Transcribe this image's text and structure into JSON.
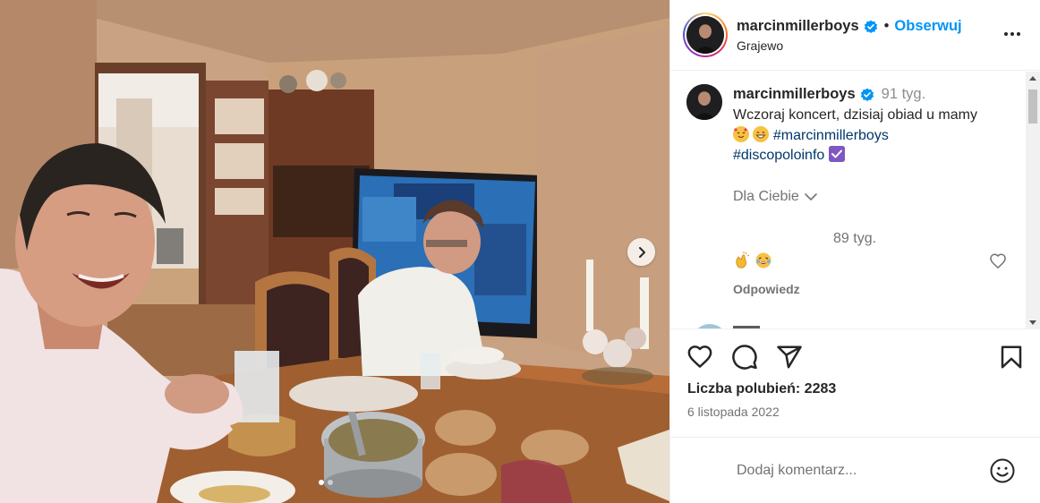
{
  "post": {
    "photo_description_icon": "photo-image",
    "carousel": {
      "slide_count": 2,
      "active_index": 0
    }
  },
  "header": {
    "username": "marcinmillerboys",
    "separator": "•",
    "follow_label": "Obserwuj",
    "location": "Grajewo",
    "more_icon": "more-horizontal-icon"
  },
  "caption": {
    "username": "marcinmillerboys",
    "time": "91 tyg.",
    "text_line1": "Wczoraj koncert, dzisiaj obiad u mamy",
    "hashtag1": "#marcinmillerboys",
    "hashtag2": "#discopoloinfo",
    "emojis": [
      "smiling-face-with-hearts",
      "grinning-face"
    ],
    "checkmark_emoji": "check-mark-button"
  },
  "filter": {
    "label": "Dla Ciebie"
  },
  "reply": {
    "time": "89 tyg.",
    "emojis": [
      "clapping-hands",
      "laughing-face"
    ],
    "reply_label": "Odpowiedz"
  },
  "actions": {
    "like_icon": "heart-icon",
    "comment_icon": "comment-icon",
    "share_icon": "share-icon",
    "save_icon": "bookmark-icon"
  },
  "likes": {
    "label": "Liczba polubień: 2283"
  },
  "date": "6 listopada 2022",
  "add_comment": {
    "placeholder": "Dodaj komentarz..."
  },
  "colors": {
    "follow_blue": "#0095f6",
    "hashtag_blue": "#00376b",
    "verified_blue": "#0095f6",
    "muted_gray": "#737373"
  }
}
